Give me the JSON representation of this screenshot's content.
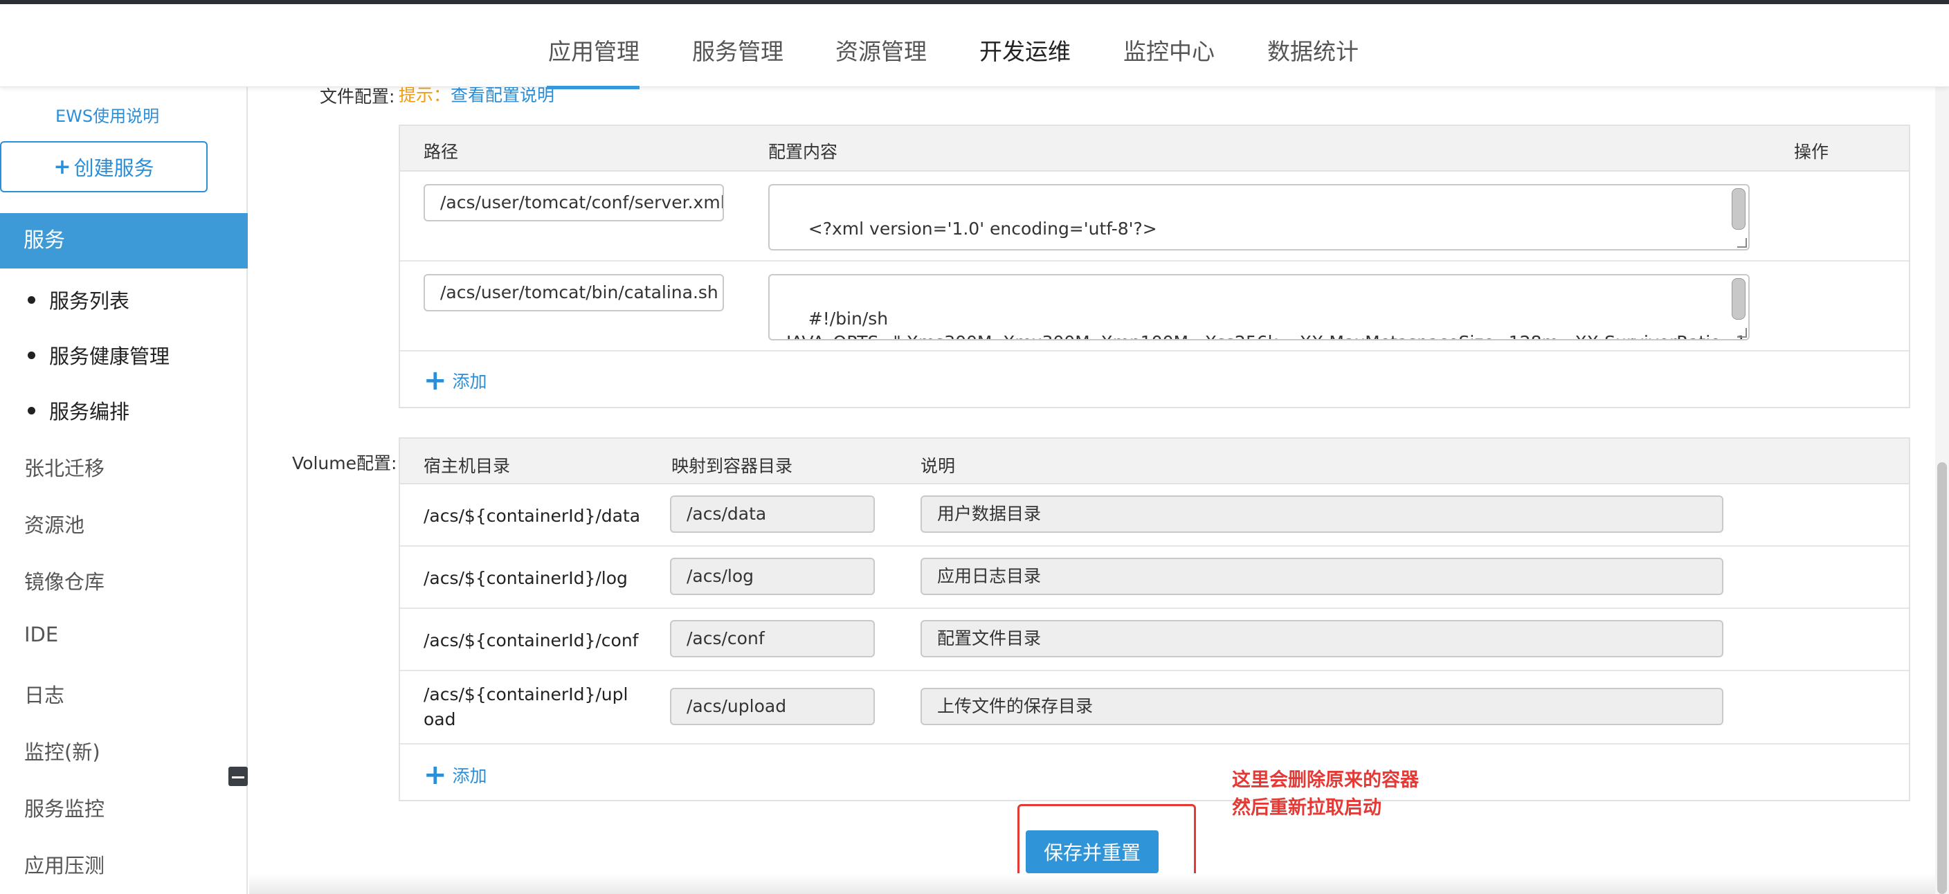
{
  "nav": {
    "items": [
      "应用管理",
      "服务管理",
      "资源管理",
      "开发运维",
      "监控中心",
      "数据统计"
    ]
  },
  "sidebar": {
    "ews_link": "EWS使用说明",
    "create_button": "创建服务",
    "active_menu": "服务",
    "sub_items": [
      "服务列表",
      "服务健康管理",
      "服务编排"
    ],
    "items": [
      "张北迁移",
      "资源池",
      "镜像仓库",
      "IDE",
      "日志",
      "监控(新)",
      "服务监控",
      "应用压测"
    ]
  },
  "file_config": {
    "label": "文件配置:",
    "hint_prefix": "提示：",
    "hint_link": "查看配置说明",
    "headers": {
      "path": "路径",
      "content": "配置内容",
      "action": "操作"
    },
    "rows": [
      {
        "path": "/acs/user/tomcat/conf/server.xml",
        "content": "<?xml version='1.0' encoding='utf-8'?>\n\n  <Server port=\"${shutdown}\" shutdown=\"SHUTDOWN\">"
      },
      {
        "path": "/acs/user/tomcat/bin/catalina.sh",
        "content": "#!/bin/sh\nJAVA_OPTS=\"-Xms300M -Xmx300M -Xmn100M  -Xss256k   -XX:MaxMetaspaceSize=128m  -XX:SurvivorRatio=10 -X\nX:+PrintGC -Xloggc:/acs/log/gc.log -Duser.timezone=Asia/Shanghai\""
      }
    ],
    "add_label": "添加"
  },
  "volume_config": {
    "label": "Volume配置:",
    "headers": {
      "host": "宿主机目录",
      "container": "映射到容器目录",
      "desc": "说明"
    },
    "rows": [
      {
        "host": "/acs/${containerId}/data",
        "container": "/acs/data",
        "desc": "用户数据目录"
      },
      {
        "host": "/acs/${containerId}/log",
        "container": "/acs/log",
        "desc": "应用日志目录"
      },
      {
        "host": "/acs/${containerId}/conf",
        "container": "/acs/conf",
        "desc": "配置文件目录"
      },
      {
        "host": "/acs/${containerId}/upload",
        "container": "/acs/upload",
        "desc": "上传文件的保存目录"
      }
    ],
    "add_label": "添加"
  },
  "annotation": {
    "line1": "这里会删除原来的容器",
    "line2": "然后重新拉取启动"
  },
  "save_button": "保存并重置",
  "colors": {
    "accent": "#3498db",
    "annotation": "#e53935",
    "warning": "#f39c12"
  }
}
